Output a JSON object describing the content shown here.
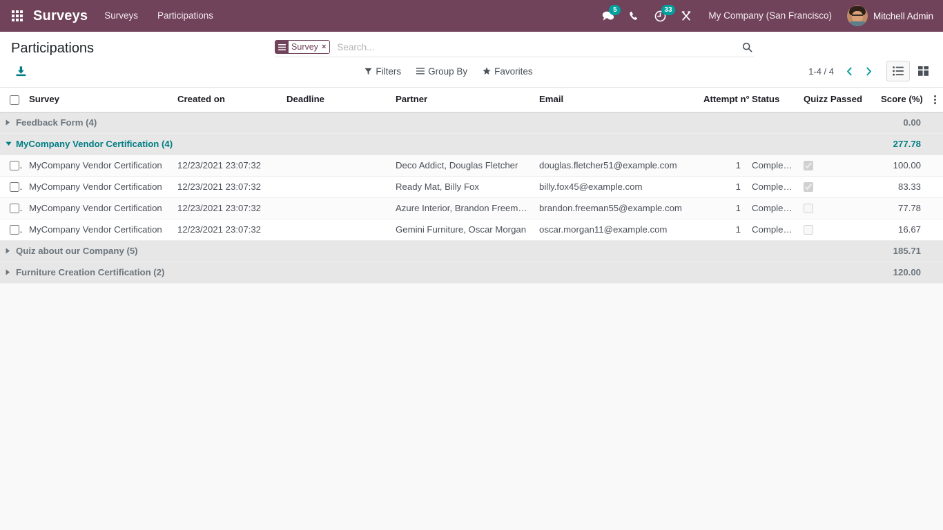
{
  "navbar": {
    "apps_icon": "grid-apps-icon",
    "brand": "Surveys",
    "menu_items": [
      {
        "label": "Surveys"
      },
      {
        "label": "Participations"
      }
    ],
    "systray": [
      {
        "icon": "messaging-icon",
        "badge": "5"
      },
      {
        "icon": "phone-icon",
        "badge": ""
      },
      {
        "icon": "activity-clock-icon",
        "badge": "33"
      },
      {
        "icon": "tools-wrench-icon",
        "badge": ""
      }
    ],
    "company": "My Company (San Francisco)",
    "user": "Mitchell Admin"
  },
  "control_panel": {
    "title": "Participations",
    "export_icon": "download-icon",
    "search": {
      "facet": {
        "icon": "group-by-icon",
        "label": "Survey",
        "remove": "×"
      },
      "placeholder": "Search...",
      "value": "",
      "search_icon": "search-icon"
    },
    "buttons": [
      {
        "icon": "filter-icon",
        "label": "Filters"
      },
      {
        "icon": "list-icon",
        "label": "Group By"
      },
      {
        "icon": "star-icon",
        "label": "Favorites"
      }
    ],
    "pager": {
      "range": "1-4 / 4",
      "previous_icon": "chevron-left-icon",
      "next_icon": "chevron-right-icon"
    },
    "views": [
      {
        "icon": "list-view-icon",
        "name": "list",
        "active": true
      },
      {
        "icon": "kanban-view-icon",
        "name": "kanban",
        "active": false
      }
    ]
  },
  "list": {
    "columns": [
      {
        "label": "Survey",
        "align": "left"
      },
      {
        "label": "Created on",
        "align": "left"
      },
      {
        "label": "Deadline",
        "align": "left"
      },
      {
        "label": "Partner",
        "align": "left"
      },
      {
        "label": "Email",
        "align": "left"
      },
      {
        "label": "Attempt n°",
        "align": "right"
      },
      {
        "label": "Status",
        "align": "left"
      },
      {
        "label": "Quizz Passed",
        "align": "left"
      },
      {
        "label": "Score (%)",
        "align": "right"
      }
    ],
    "optional_columns_icon": "vertical-dots-icon",
    "groups": [
      {
        "label": "Feedback Form (4)",
        "expanded": false,
        "score": "0.00",
        "rows": []
      },
      {
        "label": "MyCompany Vendor Certification (4)",
        "expanded": true,
        "score": "277.78",
        "rows": [
          {
            "survey": "MyCompany Vendor Certification",
            "created_on": "12/23/2021 23:07:32",
            "deadline": "",
            "partner": "Deco Addict, Douglas Fletcher",
            "email": "douglas.fletcher51@example.com",
            "attempt": "1",
            "status": "Completed",
            "quizz_passed": true,
            "score": "100.00"
          },
          {
            "survey": "MyCompany Vendor Certification",
            "created_on": "12/23/2021 23:07:32",
            "deadline": "",
            "partner": "Ready Mat, Billy Fox",
            "email": "billy.fox45@example.com",
            "attempt": "1",
            "status": "Completed",
            "quizz_passed": true,
            "score": "83.33"
          },
          {
            "survey": "MyCompany Vendor Certification",
            "created_on": "12/23/2021 23:07:32",
            "deadline": "",
            "partner": "Azure Interior, Brandon Freeman",
            "email": "brandon.freeman55@example.com",
            "attempt": "1",
            "status": "Completed",
            "quizz_passed": false,
            "score": "77.78"
          },
          {
            "survey": "MyCompany Vendor Certification",
            "created_on": "12/23/2021 23:07:32",
            "deadline": "",
            "partner": "Gemini Furniture, Oscar Morgan",
            "email": "oscar.morgan11@example.com",
            "attempt": "1",
            "status": "Completed",
            "quizz_passed": false,
            "score": "16.67"
          }
        ]
      },
      {
        "label": "Quiz about our Company (5)",
        "expanded": false,
        "score": "185.71",
        "rows": []
      },
      {
        "label": "Furniture Creation Certification (2)",
        "expanded": false,
        "score": "120.00",
        "rows": []
      }
    ]
  },
  "colors": {
    "navbar_bg": "#71435b",
    "accent_teal": "#017e84",
    "badge_teal": "#00a09d",
    "group_bg": "#e7e7e7",
    "body_bg": "#f9f9f9"
  }
}
